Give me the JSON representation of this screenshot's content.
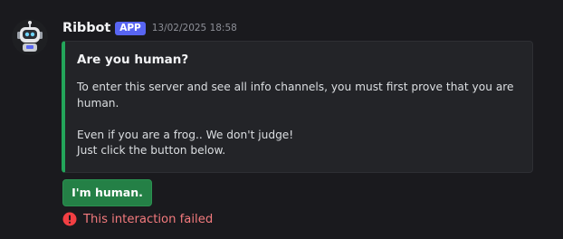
{
  "message": {
    "author": "Ribbot",
    "badge": "APP",
    "timestamp": "13/02/2025 18:58",
    "avatar_icon": "robot-avatar-icon"
  },
  "embed": {
    "title": "Are you human?",
    "accent_color": "#23a55a",
    "description": {
      "line1": "To enter this server and see all info channels, you must first prove that you are",
      "line2": "human.",
      "line3": "Even if you are a frog.. We don't judge!",
      "line4": "Just click the button below."
    }
  },
  "button": {
    "label": "I'm human.",
    "color": "#248046"
  },
  "status": {
    "error_text": "This interaction failed",
    "error_icon": "exclamation-circle-icon",
    "error_color": "#f23f43"
  }
}
